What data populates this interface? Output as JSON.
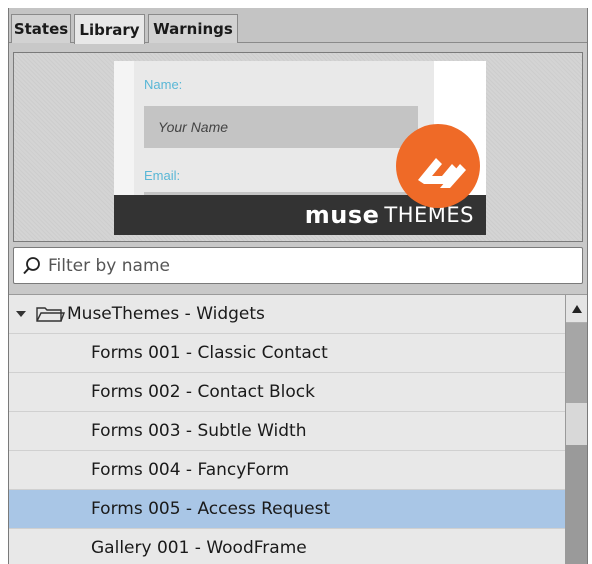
{
  "tabs": [
    {
      "label": "States",
      "active": false
    },
    {
      "label": "Library",
      "active": true
    },
    {
      "label": "Warnings",
      "active": false
    }
  ],
  "preview": {
    "name_label": "Name:",
    "name_placeholder": "Your Name",
    "email_label": "Email:",
    "brand_bold": "muse",
    "brand_regular": "THEMES",
    "logo_color": "#ef6a27"
  },
  "filter": {
    "placeholder": "Filter by name",
    "icon": "search-icon"
  },
  "tree": {
    "folder_label": "MuseThemes - Widgets",
    "folder_expanded": true,
    "items": [
      {
        "label": "Forms 001 - Classic Contact",
        "selected": false
      },
      {
        "label": "Forms 002 - Contact Block",
        "selected": false
      },
      {
        "label": "Forms 003 - Subtle Width",
        "selected": false
      },
      {
        "label": "Forms 004 - FancyForm",
        "selected": false
      },
      {
        "label": "Forms 005 - Access Request",
        "selected": true
      },
      {
        "label": "Gallery 001 - WoodFrame",
        "selected": false
      }
    ]
  },
  "colors": {
    "selection": "#a9c6e6",
    "accent": "#59b7d6"
  }
}
